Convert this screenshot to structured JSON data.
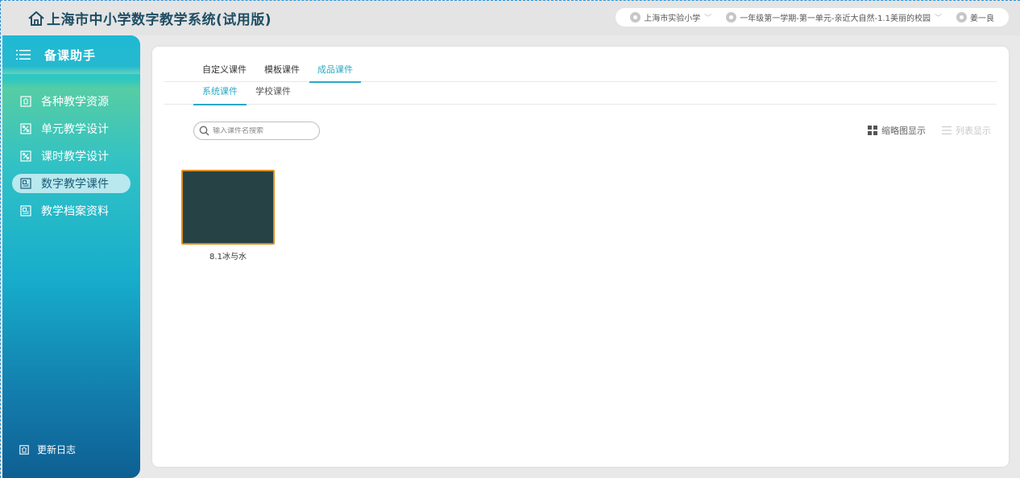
{
  "header": {
    "title": "上海市中小学数字教学系统(试用版)",
    "school": "上海市实验小学",
    "lesson": "一年级第一学期-第一单元-亲近大自然-1.1美丽的校园",
    "user": "姜一良"
  },
  "sidebar": {
    "title": "备课助手",
    "items": [
      {
        "label": "各种教学资源",
        "icon": "resource-icon"
      },
      {
        "label": "单元教学设计",
        "icon": "unit-design-icon"
      },
      {
        "label": "课时教学设计",
        "icon": "lesson-design-icon"
      },
      {
        "label": "数字教学课件",
        "icon": "courseware-icon"
      },
      {
        "label": "教学档案资料",
        "icon": "archive-icon"
      }
    ],
    "active_index": 3,
    "footer": "更新日志"
  },
  "main": {
    "tabs": [
      "自定义课件",
      "模板课件",
      "成品课件"
    ],
    "active_tab": 2,
    "subtabs": [
      "系统课件",
      "学校课件"
    ],
    "active_subtab": 0,
    "search_placeholder": "输入课件名搜索",
    "view_thumbnail": "缩略图显示",
    "view_list": "列表显示",
    "cards": [
      {
        "label": "8.1冰与水"
      }
    ]
  },
  "colors": {
    "accent": "#2aa8c4",
    "title": "#1f4e63",
    "thumb_bg": "#264245",
    "thumb_border": "#dd8f1f"
  }
}
